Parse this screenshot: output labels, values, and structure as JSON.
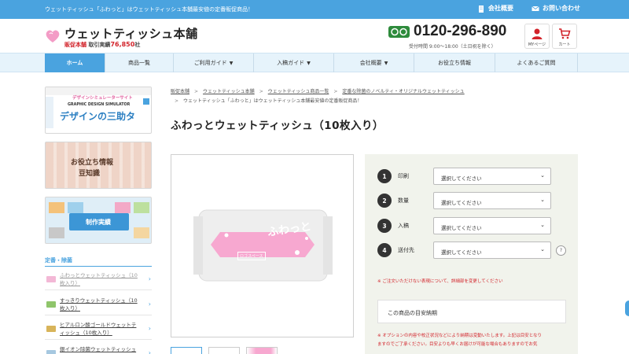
{
  "topbar": {
    "tagline": "ウェットティッシュ「ふわっと」はウェットティッシュ本舗最安値の定番販促商品！",
    "links": [
      {
        "label": "会社概要",
        "icon": "building-icon"
      },
      {
        "label": "お問い合わせ",
        "icon": "mail-icon"
      }
    ]
  },
  "header": {
    "logo_title": "ウェットティッシュ本舗",
    "logo_sub_brand": "販促本舗",
    "logo_sub_text": "取引実績",
    "logo_sub_number": "76,850",
    "logo_sub_unit": "社",
    "phone": "0120-296-890",
    "phone_hours": "受付時間 9:00〜18:00（土日祝を除く）",
    "mypage_label": "MYページ",
    "cart_label": "カート"
  },
  "nav": {
    "items": [
      {
        "label": "ホーム",
        "dropdown": false
      },
      {
        "label": "商品一覧",
        "dropdown": false
      },
      {
        "label": "ご利用ガイド",
        "dropdown": true
      },
      {
        "label": "入稿ガイド",
        "dropdown": true
      },
      {
        "label": "会社概要",
        "dropdown": true
      },
      {
        "label": "お役立ち情報",
        "dropdown": false
      },
      {
        "label": "よくあるご質問",
        "dropdown": false
      }
    ],
    "chevron": "▼"
  },
  "sidebar": {
    "banners": [
      {
        "top_text": "デザインシミュレーターサイト",
        "mid_text": "GRAPHIC DESIGN SIMULATOR",
        "main_text": "デザインの三助タ"
      },
      {
        "line1": "お役立ち情報",
        "line2": "豆知識"
      },
      {
        "label": "制作実績"
      }
    ],
    "section_title": "定番・除菌",
    "items": [
      {
        "label": "ふわっとウェットティッシュ（10枚入り）",
        "color": "#f3b8d6"
      },
      {
        "label": "すっきりウェットティッシュ（10枚入り）",
        "color": "#8fc56b"
      },
      {
        "label": "ヒアルロン酸ゴールドウェットティッシュ（10枚入り）",
        "color": "#d8b45a"
      },
      {
        "label": "銀イオン除菌ウェットティッシュ",
        "color": "#a6c8e0"
      }
    ],
    "arrow": "›"
  },
  "breadcrumb": {
    "items": [
      "販促本舗",
      "ウェットティッシュ本舗",
      "ウェットティッシュ商品一覧",
      "定番な除菌のノベルティ・オリジナルウェットティッシュ",
      "ウェットティッシュ「ふわっと」はウェットティッシュ本舗最安値の定番販促商品！"
    ],
    "separator": ">"
  },
  "product": {
    "title": "ふわっとウェットティッシュ（10枚入り）",
    "package_label": "ふわっと",
    "package_logo": "ロゴスペース"
  },
  "order": {
    "rows": [
      {
        "num": "1",
        "label": "印刷",
        "value": "選択してください"
      },
      {
        "num": "2",
        "label": "数量",
        "value": "選択してください"
      },
      {
        "num": "3",
        "label": "入稿",
        "value": "選択してください"
      },
      {
        "num": "4",
        "label": "送付先",
        "value": "選択してください"
      }
    ],
    "caret": "⌄",
    "help": "?",
    "warning1": "※ ご注文いただけない表現について、詳細部を変更してください",
    "estimate_label": "この商品の目安納期",
    "warning2_line1": "※ オプションの内容や校正状況などにより納期は変動いたします。上記は目安となり",
    "warning2_line2": "ますのでご了承ください。目安よりも早くお届けが可能な場合もありますのでお気"
  },
  "colors": {
    "accent": "#4aa3df",
    "warning": "#d2232a",
    "panel": "#f1f3ec",
    "package_pink": "#f7a8d0"
  }
}
